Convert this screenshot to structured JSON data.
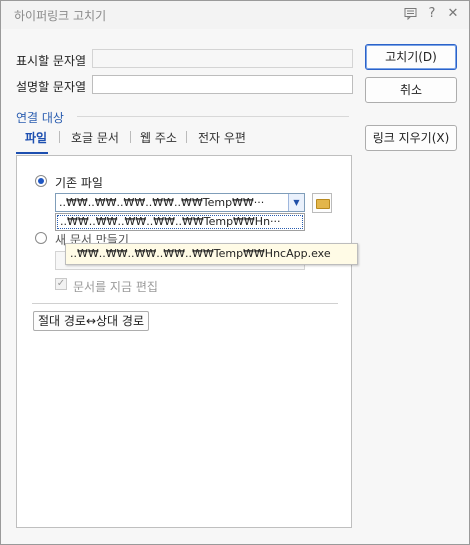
{
  "window": {
    "title": "하이퍼링크 고치기",
    "help_glyph": "?",
    "close_glyph": "✕"
  },
  "form": {
    "display_text_label": "표시할 문자열",
    "display_text_value": "",
    "description_label": "설명할 문자열",
    "description_value": ""
  },
  "buttons": {
    "ok": "고치기(D)",
    "cancel": "취소",
    "remove_link": "링크 지우기(X)"
  },
  "target": {
    "section_title": "연결 대상",
    "tabs": [
      "파일",
      "호글 문서",
      "웹 주소",
      "전자 우편"
    ],
    "active_tab": 0
  },
  "file_panel": {
    "existing_file_label": "기존 파일",
    "existing_file_selected": true,
    "combo_value": "..₩₩..₩₩..₩₩..₩₩..₩₩Temp₩₩···",
    "dropdown_item": "..₩₩..₩₩..₩₩..₩₩..₩₩Temp₩₩Hn···",
    "tooltip_text": "..₩₩..₩₩..₩₩..₩₩..₩₩Temp₩₩HncApp.exe",
    "new_doc_label": "새 문서 만들기",
    "new_doc_selected": false,
    "edit_now_label": "문서를 지금 편집",
    "edit_now_checked": true,
    "path_toggle_button": "절대 경로↔상대 경로"
  }
}
